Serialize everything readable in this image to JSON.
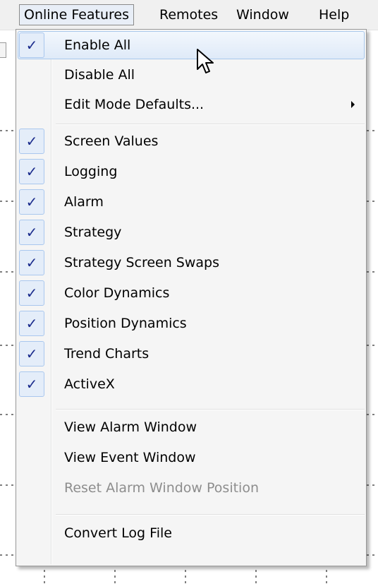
{
  "menubar": {
    "items": [
      "Online Features",
      "Remotes",
      "Window",
      "Help"
    ]
  },
  "menu": {
    "items": [
      {
        "label": "Enable All",
        "checked": true,
        "hover": true
      },
      {
        "label": "Disable All",
        "checked": false
      },
      {
        "label": "Edit Mode Defaults...",
        "checked": false,
        "submenu": true
      },
      {
        "label": "Screen Values",
        "checked": true
      },
      {
        "label": "Logging",
        "checked": true
      },
      {
        "label": "Alarm",
        "checked": true
      },
      {
        "label": "Strategy",
        "checked": true
      },
      {
        "label": "Strategy Screen Swaps",
        "checked": true
      },
      {
        "label": "Color Dynamics",
        "checked": true
      },
      {
        "label": "Position Dynamics",
        "checked": true
      },
      {
        "label": "Trend Charts",
        "checked": true
      },
      {
        "label": "ActiveX",
        "checked": true
      },
      {
        "label": "View Alarm Window",
        "checked": false
      },
      {
        "label": "View Event Window",
        "checked": false
      },
      {
        "label": "Reset Alarm Window Position",
        "checked": false,
        "disabled": true
      },
      {
        "label": "Convert Log File",
        "checked": false
      }
    ],
    "check_glyph": "✓"
  },
  "colors": {
    "check_mark": "#1a2b8c",
    "hover_border": "#a8c8ec",
    "disabled_text": "#8d8d8d"
  },
  "icons": {
    "cursor": "arrow-pointer-icon",
    "submenu": "chevron-right-icon"
  }
}
